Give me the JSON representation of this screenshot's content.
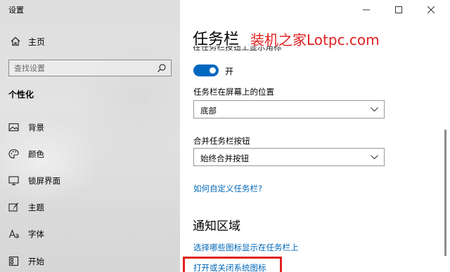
{
  "window": {
    "title": "设置",
    "controls": {
      "minimize": "minimize-icon",
      "maximize": "maximize-icon",
      "close": "close-icon"
    }
  },
  "sidebar": {
    "home_label": "主页",
    "search_placeholder": "查找设置",
    "section_heading": "个性化",
    "items": [
      {
        "label": "背景",
        "icon": "picture-icon"
      },
      {
        "label": "颜色",
        "icon": "palette-icon"
      },
      {
        "label": "锁屏界面",
        "icon": "lock-screen-icon"
      },
      {
        "label": "主题",
        "icon": "brush-icon"
      },
      {
        "label": "字体",
        "icon": "font-icon"
      },
      {
        "label": "开始",
        "icon": "start-icon"
      }
    ]
  },
  "main": {
    "page_title": "任务栏",
    "watermark": "装机之家Lotpc.com",
    "cut_off_label": "在任务栏按钮上显示角标",
    "toggle": {
      "state_label": "开",
      "on": true
    },
    "position_label": "任务栏在屏幕上的位置",
    "position_value": "底部",
    "combine_label": "合并任务栏按钮",
    "combine_value": "始终合并按钮",
    "customize_link": "如何自定义任务栏?",
    "notification_section": "通知区域",
    "select_icons_link": "选择哪些图标显示在任务栏上",
    "system_icons_link": "打开或关闭系统图标"
  },
  "colors": {
    "accent": "#0067c0",
    "link": "#0067b8",
    "highlight": "#e02020"
  }
}
